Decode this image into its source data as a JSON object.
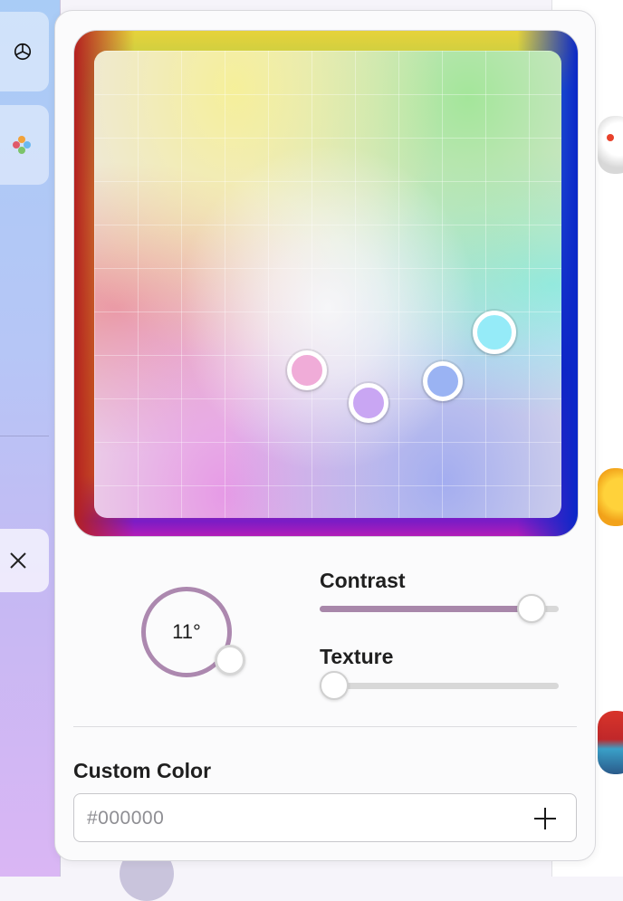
{
  "color_picker": {
    "color_dots": [
      {
        "name": "pink",
        "color": "#f0acd8"
      },
      {
        "name": "lavender",
        "color": "#c9a6f3"
      },
      {
        "name": "periwinkle",
        "color": "#9ab3f3"
      },
      {
        "name": "cyan",
        "color": "#95ebf8"
      }
    ]
  },
  "angle_dial": {
    "value": "11°",
    "accent_color": "#ac88af"
  },
  "contrast": {
    "label": "Contrast",
    "value_fraction": 0.94,
    "accent_color": "#a887aa"
  },
  "texture": {
    "label": "Texture",
    "value_fraction": 0.0
  },
  "custom_color": {
    "label": "Custom Color",
    "placeholder": "#000000",
    "add_icon": "plus-icon"
  }
}
